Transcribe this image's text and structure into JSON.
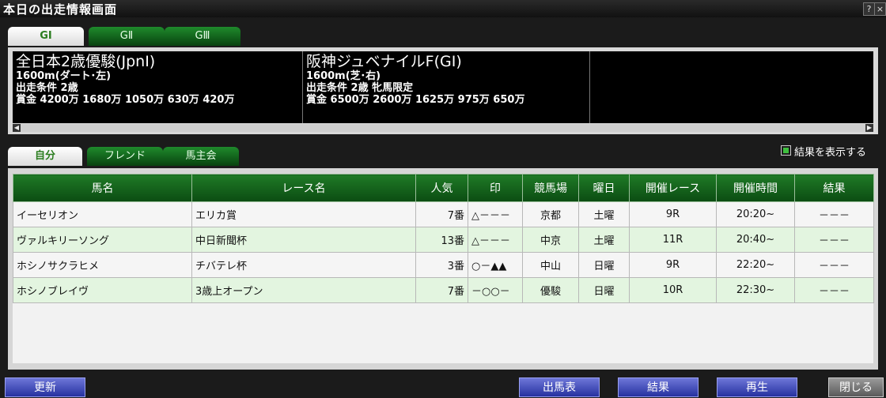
{
  "window": {
    "title": "本日の出走情報画面",
    "help": "?",
    "close": "×"
  },
  "grade_tabs": [
    "GⅠ",
    "GⅡ",
    "GⅢ"
  ],
  "races": [
    {
      "name": "全日本2歳優駿(JpnⅠ)",
      "distance": "1600m(ダート･左)",
      "condition": "出走条件 2歳",
      "prize": "賞金 4200万 1680万 1050万 630万 420万"
    },
    {
      "name": "阪神ジュベナイルF(GⅠ)",
      "distance": "1600m(芝･右)",
      "condition": "出走条件 2歳 牝馬限定",
      "prize": "賞金 6500万 2600万 1625万 975万 650万"
    }
  ],
  "scroll": {
    "left": "◀",
    "right": "▶"
  },
  "owner_tabs": [
    "自分",
    "フレンド",
    "馬主会"
  ],
  "show_results_label": "結果を表示する",
  "table": {
    "headers": [
      "馬名",
      "レース名",
      "人気",
      "印",
      "競馬場",
      "曜日",
      "開催レース",
      "開催時間",
      "結果"
    ],
    "rows": [
      [
        "イーセリオン",
        "エリカ賞",
        "7番",
        "△－－－",
        "京都",
        "土曜",
        "9R",
        "20:20~",
        "－－－"
      ],
      [
        "ヴァルキリーソング",
        "中日新聞杯",
        "13番",
        "△－－－",
        "中京",
        "土曜",
        "11R",
        "20:40~",
        "－－－"
      ],
      [
        "ホシノサクラヒメ",
        "チバテレ杯",
        "3番",
        "○－▲▲",
        "中山",
        "日曜",
        "9R",
        "22:20~",
        "－－－"
      ],
      [
        "ホシノブレイヴ",
        "3歳上オープン",
        "7番",
        "－○○－",
        "優駿",
        "日曜",
        "10R",
        "22:30~",
        "－－－"
      ]
    ]
  },
  "buttons": {
    "update": "更新",
    "entries": "出馬表",
    "results": "結果",
    "replay": "再生",
    "close": "閉じる"
  }
}
